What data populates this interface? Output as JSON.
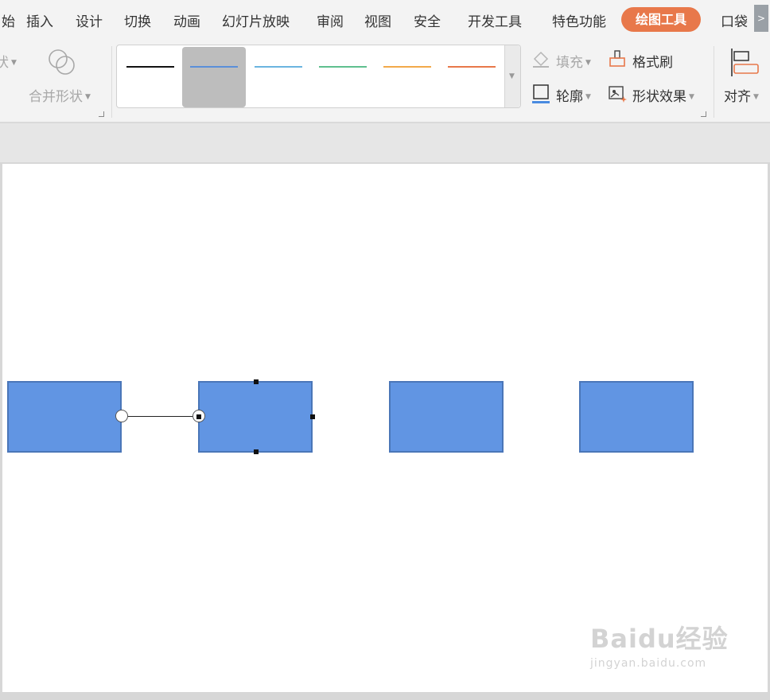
{
  "menu": {
    "items": [
      {
        "label": "始"
      },
      {
        "label": "插入"
      },
      {
        "label": "设计"
      },
      {
        "label": "切换"
      },
      {
        "label": "动画"
      },
      {
        "label": "幻灯片放映"
      },
      {
        "label": "审阅"
      },
      {
        "label": "视图"
      },
      {
        "label": "安全"
      },
      {
        "label": "开发工具"
      },
      {
        "label": "特色功能"
      },
      {
        "label": "绘图工具",
        "active": true
      },
      {
        "label": "口袋"
      }
    ],
    "scroll_icon": ">",
    "active_color": "#e8784a"
  },
  "ribbon": {
    "left_cut_label": "状",
    "merge_shapes": {
      "label": "合并形状",
      "icon": "merge-shapes-icon"
    },
    "line_styles": {
      "colors": [
        "#111111",
        "#5b8fd9",
        "#6bb4e0",
        "#5fbf8f",
        "#f2a94a",
        "#e8784a"
      ],
      "selected_index": 1
    },
    "fill": {
      "label": "填充",
      "icon": "fill-bucket-icon"
    },
    "format_painter": {
      "label": "格式刷",
      "icon": "format-painter-icon"
    },
    "outline": {
      "label": "轮廓",
      "icon": "outline-icon"
    },
    "shape_effects": {
      "label": "形状效果",
      "icon": "shape-effects-icon"
    },
    "align": {
      "label": "对齐",
      "icon": "align-icon"
    }
  },
  "canvas": {
    "shape_fill": "#6195e3",
    "shape_border": "#4a76b8",
    "shapes_count": 4,
    "connector": {
      "color": "#222222"
    }
  },
  "watermark": {
    "main": "Baidu经验",
    "sub": "jingyan.baidu.com"
  }
}
